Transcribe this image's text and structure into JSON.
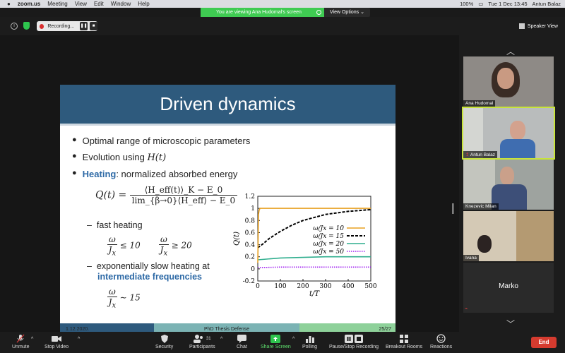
{
  "menubar": {
    "app": "zoom.us",
    "menus": [
      "Meeting",
      "View",
      "Edit",
      "Window",
      "Help"
    ],
    "battery": "100%",
    "datetime": "Tue 1 Dec 13:45",
    "user": "Antun Balaz"
  },
  "share_banner": {
    "text": "You are viewing Ana Hudomal's screen",
    "view_options": "View Options"
  },
  "topbar": {
    "recording_label": "Recording...",
    "speaker_view": "Speaker View"
  },
  "slide": {
    "title": "Driven dynamics",
    "bullets": [
      "Optimal range of microscopic parameters",
      "Evolution using",
      "Heating",
      ": normalized absorbed energy"
    ],
    "evolution_math": "H(t)",
    "formula_lhs": "Q(t) =",
    "formula_num": "⟨H_eff(t)⟩_K − E_0",
    "formula_den": "lim_{β→0}⟨H_eff⟩ − E_0",
    "fast_heating": "fast heating",
    "exp_slow": "exponentially slow heating at",
    "intermediate": "intermediate frequencies",
    "ratio_w": "ω",
    "ratio_jx": "J",
    "ratio_le": "≤ 10",
    "ratio_ge": "≥ 20",
    "ratio_sim": "∼ 15",
    "footer_date": "1.12.2020.",
    "footer_title": "PhD Thesis Defense",
    "footer_page": "25/27"
  },
  "chart_data": {
    "type": "line",
    "xlabel": "t/T",
    "ylabel": "Q(t)",
    "xlim": [
      0,
      500
    ],
    "ylim": [
      -0.2,
      1.2
    ],
    "x_ticks": [
      "0",
      "100",
      "200",
      "300",
      "400",
      "500"
    ],
    "y_ticks": [
      "-0.2",
      "0",
      "0.2",
      "0.4",
      "0.6",
      "0.8",
      "1",
      "1.2"
    ],
    "legend_position": "center-right",
    "series": [
      {
        "name": "ω/Jx = 50",
        "color": "#a020f0",
        "style": "dotted",
        "x": [
          0,
          100,
          200,
          300,
          400,
          500
        ],
        "y": [
          0.02,
          0.03,
          0.03,
          0.03,
          0.03,
          0.03
        ]
      },
      {
        "name": "ω/Jx = 20",
        "color": "#2fae8e",
        "style": "solid",
        "x": [
          0,
          100,
          200,
          300,
          400,
          500
        ],
        "y": [
          0.15,
          0.18,
          0.19,
          0.2,
          0.2,
          0.2
        ]
      },
      {
        "name": "ω/Jx = 15",
        "color": "#000000",
        "style": "dashed",
        "x": [
          0,
          25,
          50,
          100,
          150,
          200,
          300,
          400,
          500
        ],
        "y": [
          0.35,
          0.42,
          0.5,
          0.62,
          0.72,
          0.8,
          0.9,
          0.95,
          0.98
        ]
      },
      {
        "name": "ω/Jx = 10",
        "color": "#e8a020",
        "style": "solid",
        "x": [
          0,
          3,
          6,
          10,
          20,
          100,
          300,
          500
        ],
        "y": [
          0.1,
          0.9,
          0.97,
          1.0,
          1.0,
          1.0,
          1.0,
          1.0
        ]
      }
    ]
  },
  "participants": [
    {
      "name": "Ana Hudomal"
    },
    {
      "name": "Antun Balaz"
    },
    {
      "name": "Knezevic Milan"
    },
    {
      "name": "Ivana"
    },
    {
      "name": "Marko"
    }
  ],
  "toolbar": {
    "unmute": "Unmute",
    "stop_video": "Stop Video",
    "security": "Security",
    "participants": "Participants",
    "participants_count": "31",
    "chat": "Chat",
    "share_screen": "Share Screen",
    "polling": "Polling",
    "pause_recording": "Pause/Stop Recording",
    "breakout": "Breakout Rooms",
    "reactions": "Reactions",
    "end": "End"
  }
}
